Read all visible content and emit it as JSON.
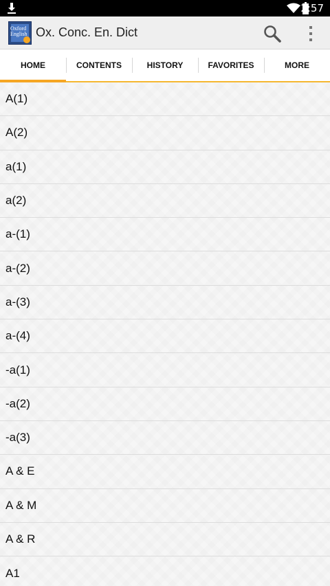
{
  "status_bar": {
    "time": "2:57"
  },
  "app_bar": {
    "title": "Ox. Conc. En. Dict",
    "logo_text": "Oxford English"
  },
  "tabs": [
    {
      "label": "HOME",
      "active": true
    },
    {
      "label": "CONTENTS",
      "active": false
    },
    {
      "label": "HISTORY",
      "active": false
    },
    {
      "label": "FAVORITES",
      "active": false
    },
    {
      "label": "MORE",
      "active": false
    }
  ],
  "entries": [
    "A(1)",
    "A(2)",
    "a(1)",
    "a(2)",
    "a-(1)",
    "a-(2)",
    "a-(3)",
    "a-(4)",
    "-a(1)",
    "-a(2)",
    "-a(3)",
    "A & E",
    "A & M",
    "A & R",
    "A1"
  ]
}
